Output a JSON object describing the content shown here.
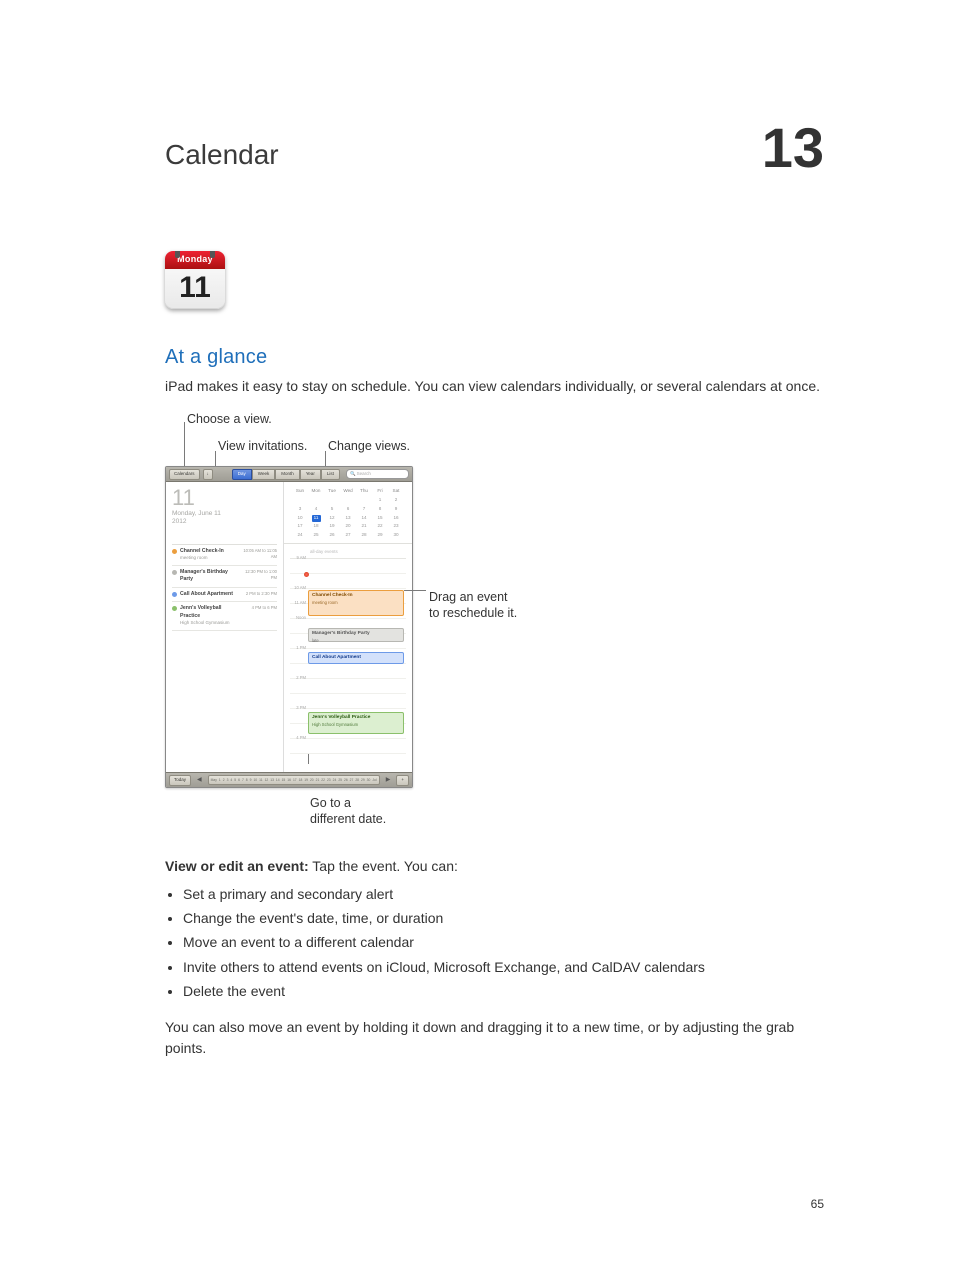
{
  "chapter": {
    "title": "Calendar",
    "number": "13"
  },
  "app_icon": {
    "weekday": "Monday",
    "day": "11"
  },
  "section_title": "At a glance",
  "intro_body": "iPad makes it easy to stay on schedule. You can view calendars individually, or several calendars at once.",
  "callouts": {
    "choose_view": "Choose a view.",
    "view_invitations": "View invitations.",
    "change_views": "Change views.",
    "drag_l1": "Drag an event",
    "drag_l2": "to reschedule it.",
    "goto_l1": "Go to a",
    "goto_l2": "different date."
  },
  "screenshot": {
    "toolbar": {
      "calendars": "Calendars",
      "invite_icon": "↓",
      "views": [
        "Day",
        "Week",
        "Month",
        "Year",
        "List"
      ],
      "active_view": "Day",
      "search_placeholder": "Search"
    },
    "bigday": "11",
    "date_line1": "Monday, June 11",
    "date_line2": "2012",
    "event_list": [
      {
        "color": "#eb9e3e",
        "name": "Channel Check-In",
        "sub": "meeting room",
        "time": "10:05 AM to 11:05 AM"
      },
      {
        "color": "#b7b7b2",
        "name": "Manager's Birthday Party",
        "sub": "",
        "time": "12:30 PM to 1:00 PM"
      },
      {
        "color": "#6d9ae8",
        "name": "Call About Apartment",
        "sub": "",
        "time": "2 PM to 2:30 PM"
      },
      {
        "color": "#8bc06b",
        "name": "Jenn's Volleyball Practice",
        "sub": "High School Gymnasium",
        "time": "4 PM to 6 PM"
      }
    ],
    "minical": {
      "headers": [
        "Sun",
        "Mon",
        "Tue",
        "Wed",
        "Thu",
        "Fri",
        "Sat"
      ],
      "cells": [
        "",
        "",
        "",
        "",
        "",
        "1",
        "2",
        "3",
        "4",
        "5",
        "6",
        "7",
        "8",
        "9",
        "10",
        "11",
        "12",
        "13",
        "14",
        "15",
        "16",
        "17",
        "18",
        "19",
        "20",
        "21",
        "22",
        "23",
        "24",
        "25",
        "26",
        "27",
        "28",
        "29",
        "30"
      ],
      "current": "11"
    },
    "allday_label": "all-day events",
    "hours": [
      "9 AM",
      "",
      "10 AM",
      "11 AM",
      "Noon",
      "",
      "1 PM",
      "",
      "2 PM",
      "",
      "3 PM",
      "",
      "4 PM"
    ],
    "bottombar": {
      "today": "Today",
      "plus": "+"
    },
    "date_ticks": [
      "May",
      "1",
      "2",
      "3",
      "4",
      "5",
      "6",
      "7",
      "8",
      "9",
      "10",
      "11",
      "12",
      "13",
      "14",
      "15",
      "16",
      "17",
      "18",
      "19",
      "20",
      "21",
      "22",
      "23",
      "24",
      "25",
      "26",
      "27",
      "28",
      "29",
      "30",
      "Jul"
    ]
  },
  "action": {
    "bold": "View or edit an event:",
    "rest": "  Tap the event. You can:"
  },
  "bullets": [
    "Set a primary and secondary alert",
    "Change the event's date, time, or duration",
    "Move an event to a different calendar",
    "Invite others to attend events on iCloud, Microsoft Exchange, and CalDAV calendars",
    "Delete the event"
  ],
  "footer_body": "You can also move an event by holding it down and dragging it to a new time, or by adjusting the grab points.",
  "page_number": "65"
}
